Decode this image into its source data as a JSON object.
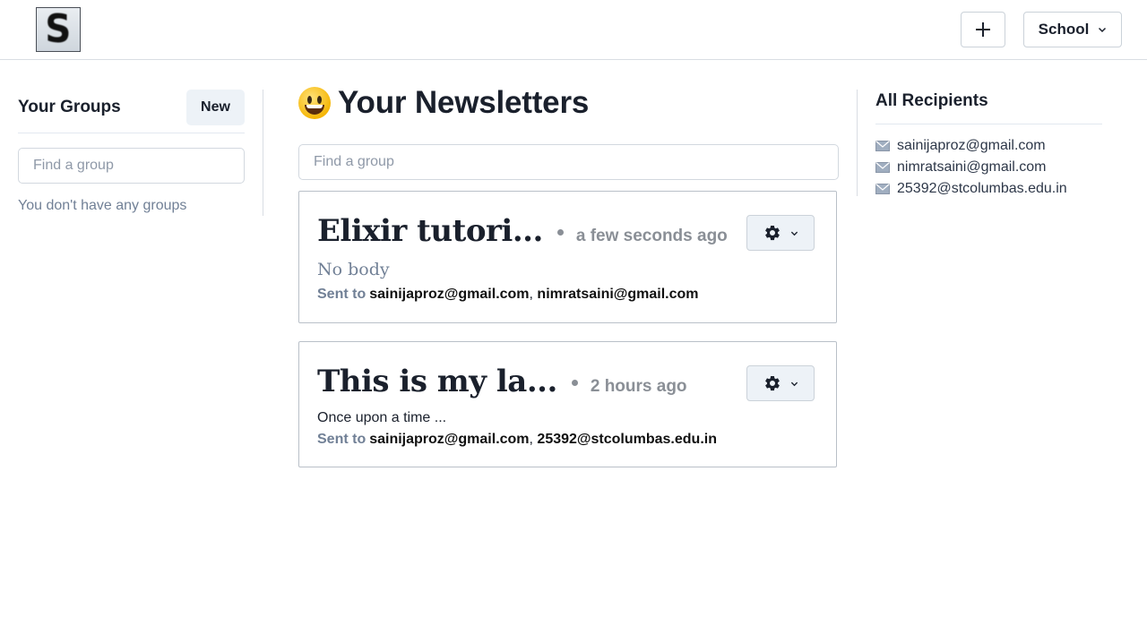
{
  "header": {
    "logo_letter": "S",
    "add_icon": "plus-icon",
    "workspace_label": "School",
    "workspace_icon": "chevron-down-icon"
  },
  "groups": {
    "title": "Your Groups",
    "new_label": "New",
    "search_placeholder": "Find a group",
    "empty_text": "You don't have any groups"
  },
  "main": {
    "emoji": "grinning-face-icon",
    "title": "Your Newsletters",
    "search_placeholder": "Find a group",
    "sent_label": "Sent to",
    "newsletters": [
      {
        "title": "Elixir tutori...",
        "time": "a few seconds ago",
        "body": "No body",
        "recipients": [
          "sainijaproz@gmail.com",
          "nimratsaini@gmail.com"
        ]
      },
      {
        "title": "This is my la...",
        "time": "2 hours ago",
        "body": "Once upon a time ...",
        "recipients": [
          "sainijaproz@gmail.com",
          "25392@stcolumbas.edu.in"
        ]
      }
    ]
  },
  "recipients": {
    "title": "All Recipients",
    "icon": "envelope-icon",
    "items": [
      "sainijaproz@gmail.com",
      "nimratsaini@gmail.com",
      "25392@stcolumbas.edu.in"
    ]
  },
  "colors": {
    "muted": "#718096",
    "border": "#cbd2d9",
    "button_bg": "#edf2f7"
  }
}
